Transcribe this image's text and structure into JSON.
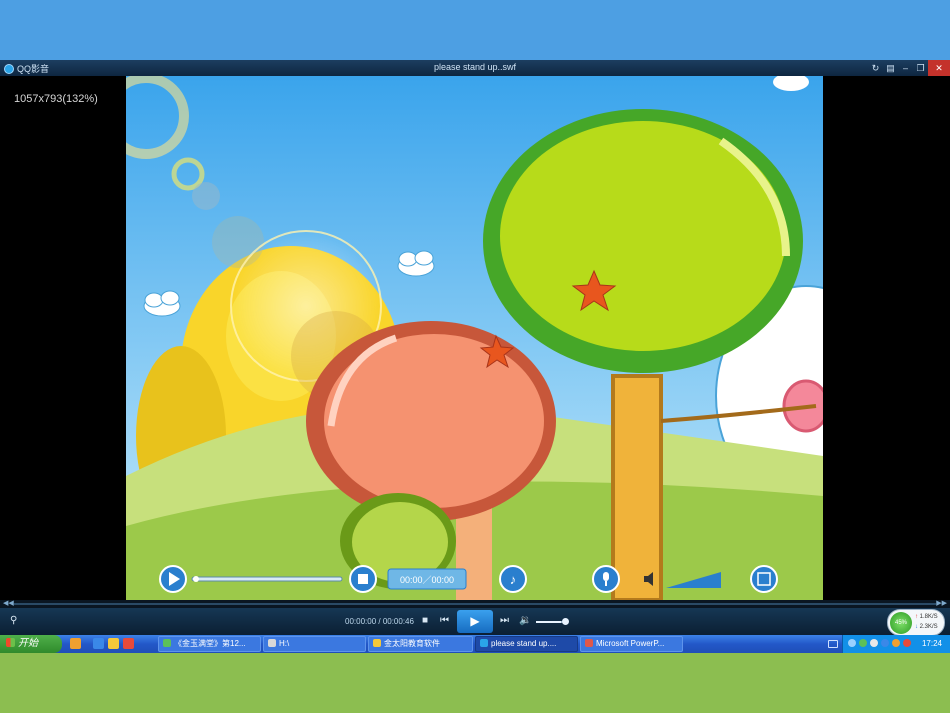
{
  "window": {
    "app_name": "QQ影音",
    "file_title": "please stand up..swf",
    "resolution_info": "1057x793(132%)"
  },
  "player": {
    "current_time": "00:00:00",
    "total_time": "00:00:46",
    "time_separator": " / ",
    "overlay_time": "00:00／00:00",
    "volume_level": 0.85
  },
  "net_speed": {
    "percent": "45%",
    "upload": "1.8K/S",
    "download": "2.3K/S"
  },
  "taskbar": {
    "start_label": "开始",
    "tasks": [
      "《金玉满堂》第12...",
      "H:\\",
      "金太阳教育软件",
      "please stand up....",
      "Microsoft PowerP..."
    ],
    "clock": "17:24"
  },
  "colors": {
    "sky": "#56b8ee",
    "hill": "#9cc94a",
    "tree_green": "#b7db1a",
    "tree_orange": "#f59270",
    "accent": "#2aa4e8"
  }
}
